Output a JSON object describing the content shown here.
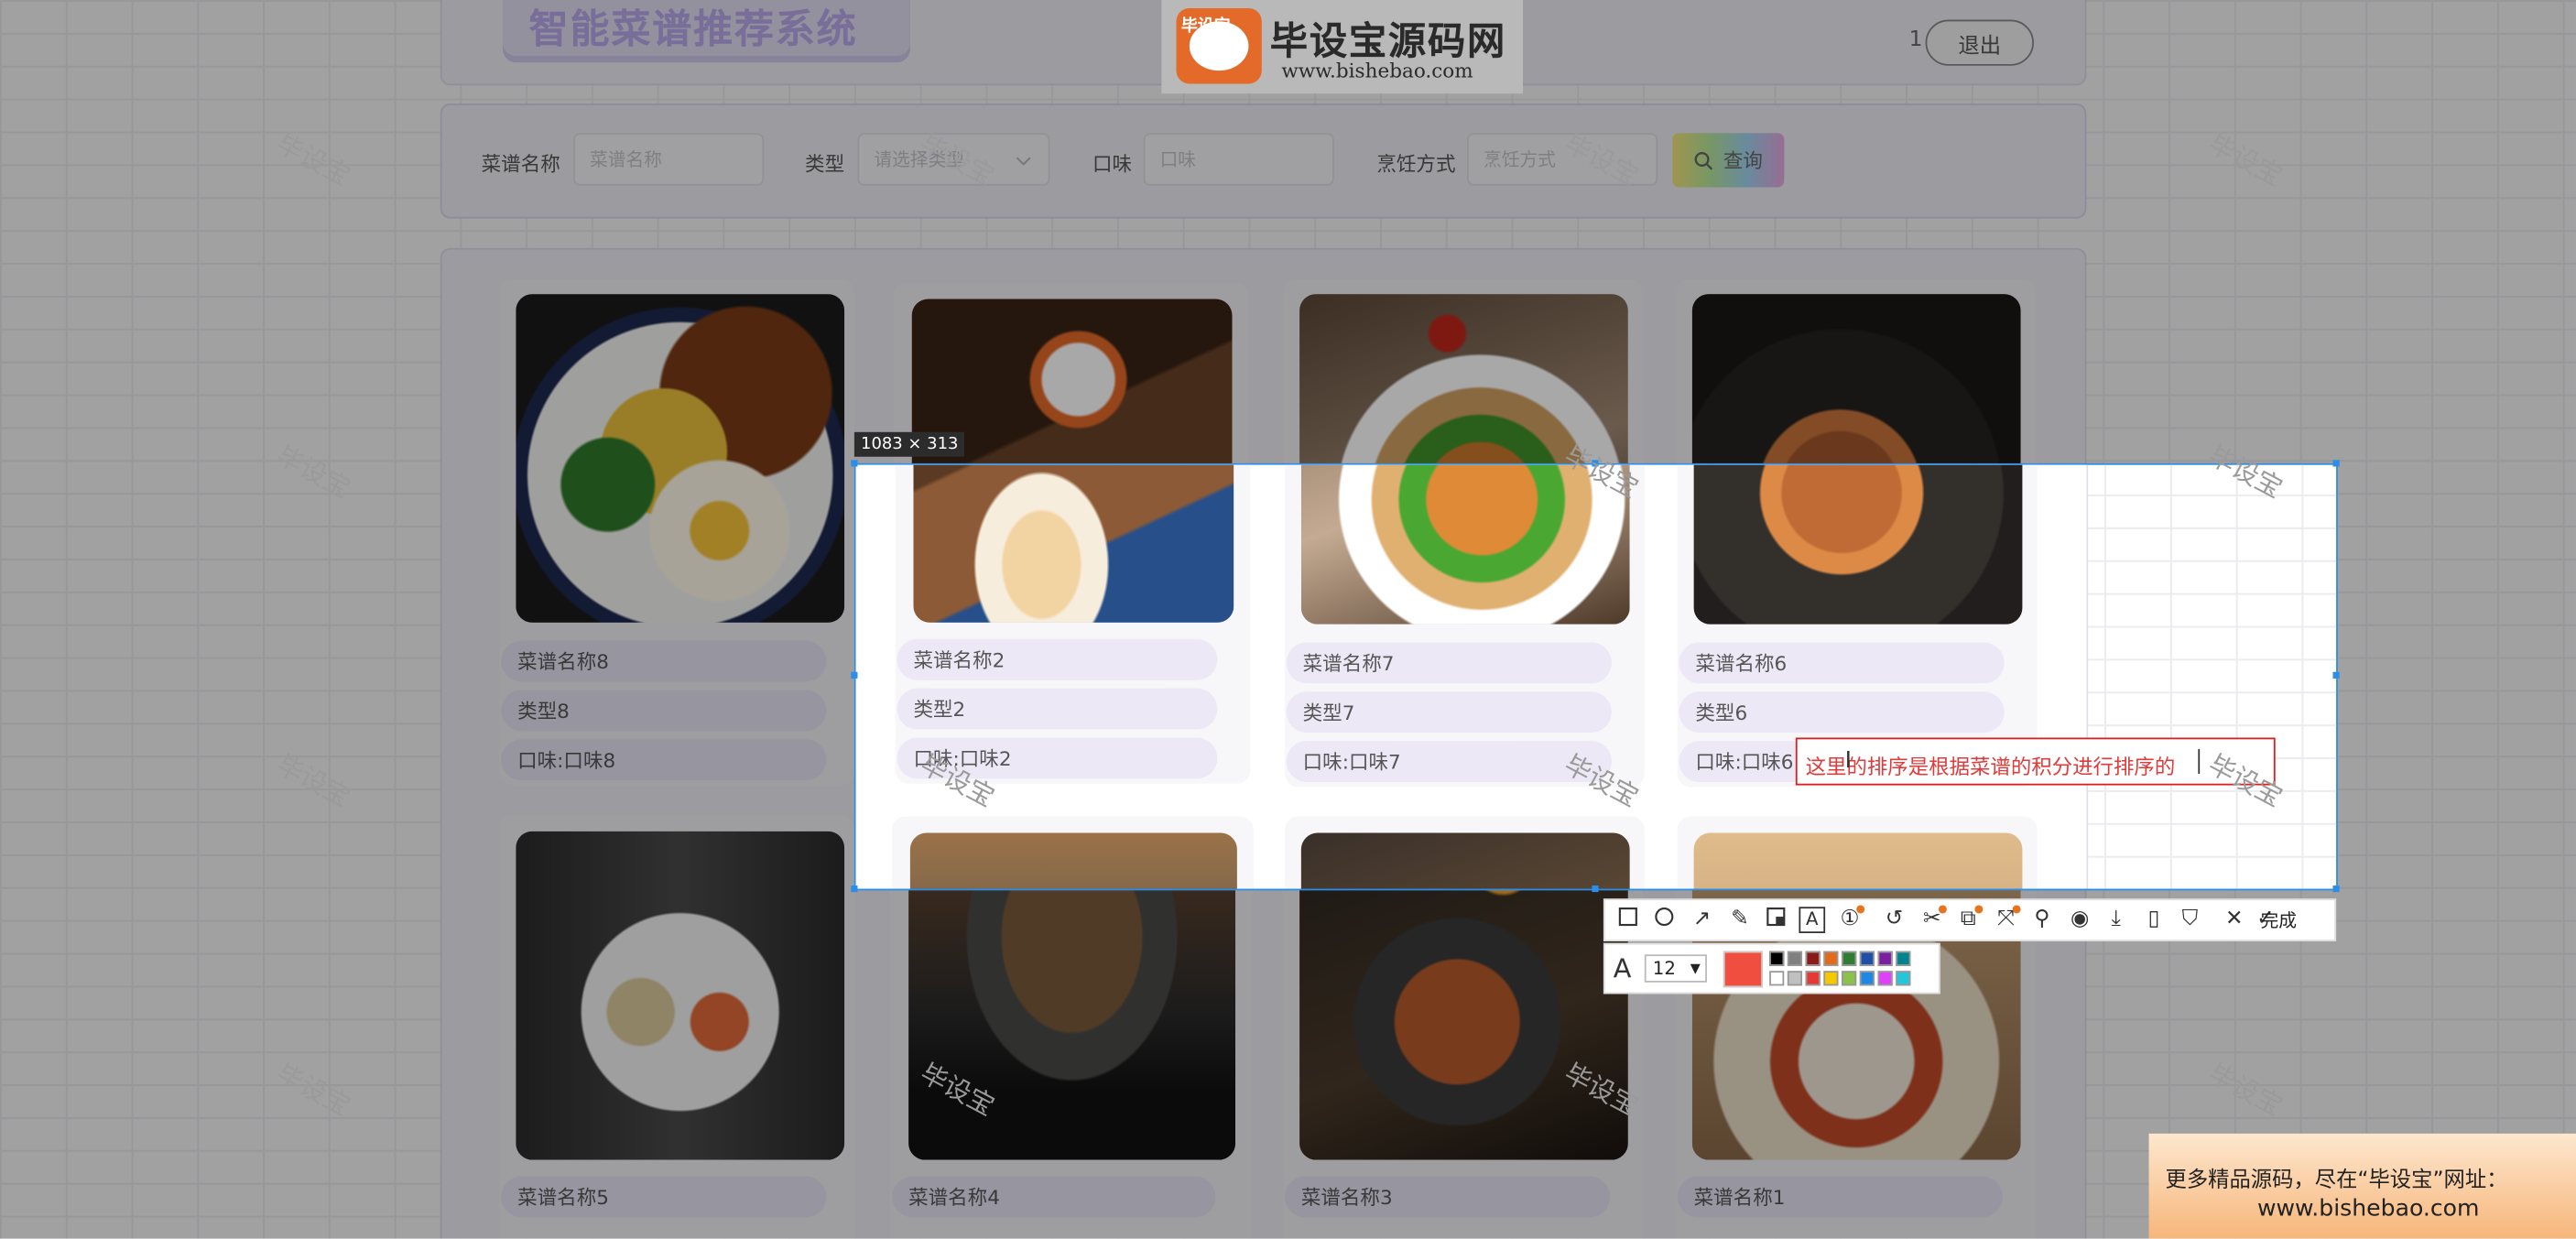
{
  "header": {
    "system_title": "智能菜谱推荐系统",
    "user_number": "1",
    "logout_label": "退出"
  },
  "logo": {
    "badge_text": "毕设宝",
    "name": "毕设宝源码网",
    "url": "www.bishebao.com"
  },
  "search": {
    "fields": [
      {
        "label": "菜谱名称",
        "placeholder": "菜谱名称"
      },
      {
        "label": "类型",
        "placeholder": "请选择类型"
      },
      {
        "label": "口味",
        "placeholder": "口味"
      },
      {
        "label": "烹饪方式",
        "placeholder": "烹饪方式"
      }
    ],
    "query_label": "查询"
  },
  "recipes": [
    {
      "name": "菜谱名称8",
      "type": "类型8",
      "taste": "口味:口味8"
    },
    {
      "name": "菜谱名称2",
      "type": "类型2",
      "taste": "口味:口味2"
    },
    {
      "name": "菜谱名称7",
      "type": "类型7",
      "taste": "口味:口味7"
    },
    {
      "name": "菜谱名称6",
      "type": "类型6",
      "taste": "口味:口味6"
    },
    {
      "name": "菜谱名称5",
      "type": "",
      "taste": ""
    },
    {
      "name": "菜谱名称4",
      "type": "",
      "taste": ""
    },
    {
      "name": "菜谱名称3",
      "type": "",
      "taste": ""
    },
    {
      "name": "菜谱名称1",
      "type": "",
      "taste": ""
    }
  ],
  "screenshot_tool": {
    "size_label": "1083 × 313",
    "annotation_text": "这里的排序是根据菜谱的积分进行排序的",
    "done_label": "完成",
    "font_size": "12",
    "current_color": "#f04e3e",
    "palette_top": [
      "#000000",
      "#808080",
      "#8b1a1a",
      "#e46a1a",
      "#2e7d32",
      "#1f4fa8",
      "#7b1fa2",
      "#00838f"
    ],
    "palette_bottom": [
      "#ffffff",
      "#c0c0c0",
      "#e53935",
      "#f5c800",
      "#8bc34a",
      "#1e88e5",
      "#e040fb",
      "#26c6da"
    ],
    "tool_icons": [
      "rectangle-icon",
      "ellipse-icon",
      "arrow-icon",
      "pen-icon",
      "mosaic-icon",
      "text-icon",
      "serial-number-icon",
      "undo-icon",
      "cut-icon",
      "ocr-icon",
      "scroll-capture-icon",
      "pin-icon",
      "record-icon",
      "save-icon",
      "phone-icon",
      "bookmark-icon",
      "close-icon",
      "check-icon"
    ]
  },
  "watermark": "毕设宝",
  "footer": {
    "line1": "更多精品源码，尽在“毕设宝”网址：",
    "line2": "www.bishebao.com"
  }
}
